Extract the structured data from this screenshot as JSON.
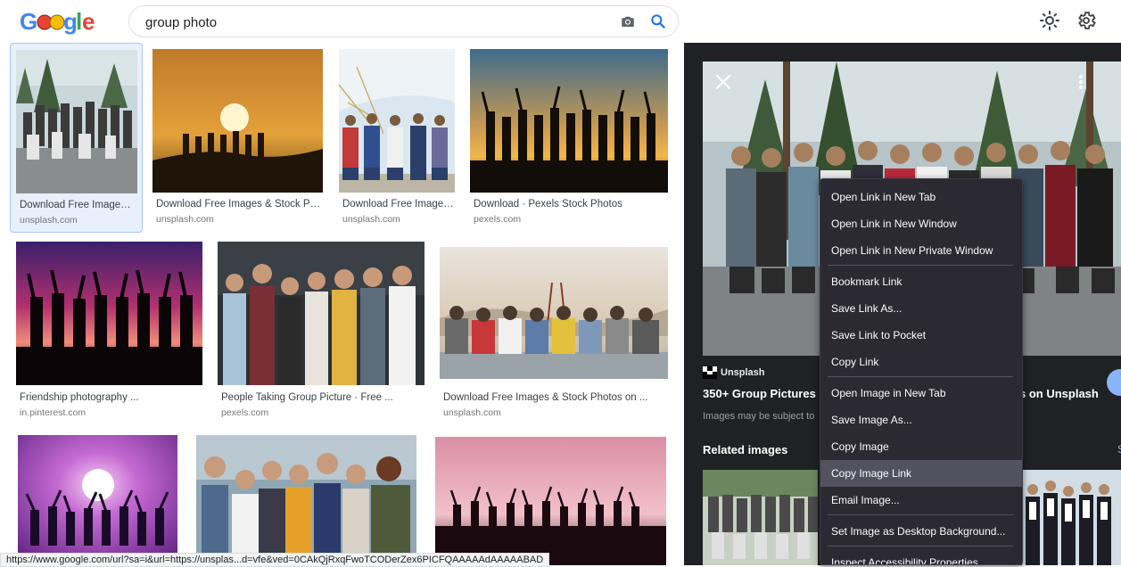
{
  "header": {
    "logo_label": "Google",
    "search_value": "group photo",
    "icons": [
      "camera-icon",
      "search-icon",
      "brightness-icon",
      "settings-icon"
    ]
  },
  "results": [
    {
      "title": "Download Free Images ...",
      "source": "unsplash.com"
    },
    {
      "title": "Download Free Images & Stock Pho...",
      "source": "unsplash.com"
    },
    {
      "title": "Download Free Images...",
      "source": "unsplash.com"
    },
    {
      "title": "Download · Pexels Stock Photos",
      "source": "pexels.com"
    },
    {
      "title": "Friendship photography ...",
      "source": "in.pinterest.com"
    },
    {
      "title": "People Taking Group Picture · Free ...",
      "source": "pexels.com"
    },
    {
      "title": "Download Free Images & Stock Photos on ...",
      "source": "unsplash.com"
    }
  ],
  "status_bar": "https://www.google.com/url?sa=i&url=https://unsplas...d=vfe&ved=0CAkQjRxqFwoTCODerZex6PICFQAAAAAdAAAAABAD",
  "panel": {
    "site": "Unsplash",
    "title_left": "350+ Group Pictures |",
    "title_right": "s on Unsplash",
    "note": "Images may be subject to",
    "related_label": "Related images",
    "see_more": "S"
  },
  "context_menu": {
    "items": [
      {
        "label": "Open Link in New Tab"
      },
      {
        "label": "Open Link in New Window"
      },
      {
        "label": "Open Link in New Private Window"
      },
      {
        "label": "Bookmark Link"
      },
      {
        "label": "Save Link As..."
      },
      {
        "label": "Save Link to Pocket"
      },
      {
        "label": "Copy Link"
      },
      {
        "label": "Open Image in New Tab"
      },
      {
        "label": "Save Image As..."
      },
      {
        "label": "Copy Image"
      },
      {
        "label": "Copy Image Link",
        "hovered": true
      },
      {
        "label": "Email Image..."
      },
      {
        "label": "Set Image as Desktop Background..."
      },
      {
        "label": "Inspect Accessibility Properties"
      }
    ]
  },
  "colors": {
    "link_blue": "#1a73e8",
    "panel_bg": "#202124",
    "menu_bg": "#2b2a33",
    "menu_hover": "#52525e"
  }
}
